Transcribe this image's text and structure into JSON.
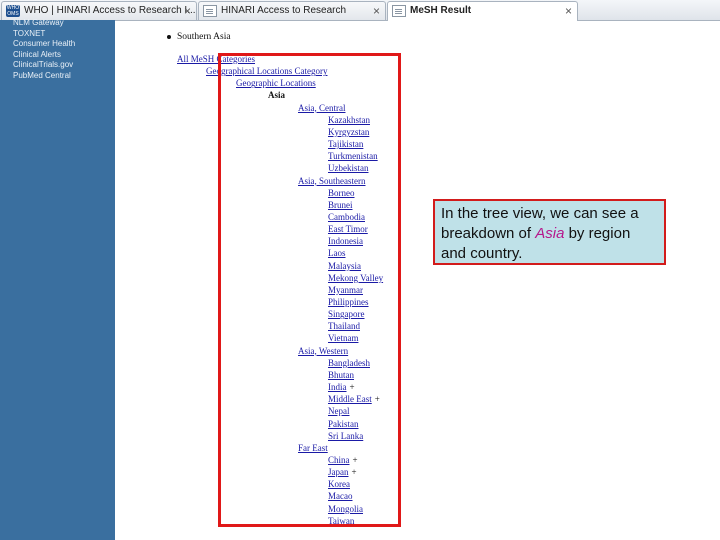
{
  "browser": {
    "tabs": [
      {
        "label": "WHO | HINARI Access to Research I...",
        "icon": "who-logo-icon",
        "close": "×",
        "active": false
      },
      {
        "label": "HINARI Access to Research",
        "icon": "page-icon",
        "close": "×",
        "active": false
      },
      {
        "label": "MeSH Result",
        "icon": "page-icon",
        "close": "×",
        "active": true
      }
    ]
  },
  "sidebar": {
    "items": [
      "NLM Gateway",
      "TOXNET",
      "Consumer Health",
      "Clinical Alerts",
      "ClinicalTrials.gov",
      "PubMed Central"
    ]
  },
  "heading": "Southern Asia",
  "tree": [
    {
      "label": "All MeSH Categories",
      "level": 0,
      "link": true,
      "mark": ""
    },
    {
      "label": "Geographical Locations Category",
      "level": 1,
      "link": true,
      "mark": ""
    },
    {
      "label": "Geographic Locations",
      "level": 2,
      "link": true,
      "mark": ""
    },
    {
      "label": "Asia",
      "level": 3,
      "link": false,
      "mark": ""
    },
    {
      "label": "Asia, Central",
      "level": 4,
      "link": true,
      "mark": ""
    },
    {
      "label": "Kazakhstan",
      "level": 5,
      "link": true,
      "mark": ""
    },
    {
      "label": "Kyrgyzstan",
      "level": 5,
      "link": true,
      "mark": ""
    },
    {
      "label": "Tajikistan",
      "level": 5,
      "link": true,
      "mark": ""
    },
    {
      "label": "Turkmenistan",
      "level": 5,
      "link": true,
      "mark": ""
    },
    {
      "label": "Uzbekistan",
      "level": 5,
      "link": true,
      "mark": ""
    },
    {
      "label": "Asia, Southeastern",
      "level": 4,
      "link": true,
      "mark": ""
    },
    {
      "label": "Borneo",
      "level": 5,
      "link": true,
      "mark": ""
    },
    {
      "label": "Brunei",
      "level": 5,
      "link": true,
      "mark": ""
    },
    {
      "label": "Cambodia",
      "level": 5,
      "link": true,
      "mark": ""
    },
    {
      "label": "East Timor",
      "level": 5,
      "link": true,
      "mark": ""
    },
    {
      "label": "Indonesia",
      "level": 5,
      "link": true,
      "mark": ""
    },
    {
      "label": "Laos",
      "level": 5,
      "link": true,
      "mark": ""
    },
    {
      "label": "Malaysia",
      "level": 5,
      "link": true,
      "mark": ""
    },
    {
      "label": "Mekong Valley",
      "level": 5,
      "link": true,
      "mark": ""
    },
    {
      "label": "Myanmar",
      "level": 5,
      "link": true,
      "mark": ""
    },
    {
      "label": "Philippines",
      "level": 5,
      "link": true,
      "mark": ""
    },
    {
      "label": "Singapore",
      "level": 5,
      "link": true,
      "mark": ""
    },
    {
      "label": "Thailand",
      "level": 5,
      "link": true,
      "mark": ""
    },
    {
      "label": "Vietnam",
      "level": 5,
      "link": true,
      "mark": ""
    },
    {
      "label": "Asia, Western",
      "level": 4,
      "link": true,
      "mark": ""
    },
    {
      "label": "Bangladesh",
      "level": 5,
      "link": true,
      "mark": ""
    },
    {
      "label": "Bhutan",
      "level": 5,
      "link": true,
      "mark": ""
    },
    {
      "label": "India",
      "level": 5,
      "link": true,
      "mark": "+"
    },
    {
      "label": "Middle East",
      "level": 5,
      "link": true,
      "mark": "+"
    },
    {
      "label": "Nepal",
      "level": 5,
      "link": true,
      "mark": ""
    },
    {
      "label": "Pakistan",
      "level": 5,
      "link": true,
      "mark": ""
    },
    {
      "label": "Sri Lanka",
      "level": 5,
      "link": true,
      "mark": ""
    },
    {
      "label": "Far East",
      "level": 4,
      "link": true,
      "mark": ""
    },
    {
      "label": "China",
      "level": 5,
      "link": true,
      "mark": "+"
    },
    {
      "label": "Japan",
      "level": 5,
      "link": true,
      "mark": "+"
    },
    {
      "label": "Korea",
      "level": 5,
      "link": true,
      "mark": ""
    },
    {
      "label": "Macao",
      "level": 5,
      "link": true,
      "mark": ""
    },
    {
      "label": "Mongolia",
      "level": 5,
      "link": true,
      "mark": ""
    },
    {
      "label": "Taiwan",
      "level": 5,
      "link": true,
      "mark": ""
    }
  ],
  "callout": {
    "before": "In the tree view, we can see a breakdown of ",
    "highlight": "Asia",
    "after": " by region and country."
  },
  "colors": {
    "sidebar": "#3a6f9f",
    "link": "#1a1aa6",
    "highlight_frame": "#e01818",
    "callout_bg": "#bfe1e8",
    "callout_highlight": "#b5178c"
  }
}
